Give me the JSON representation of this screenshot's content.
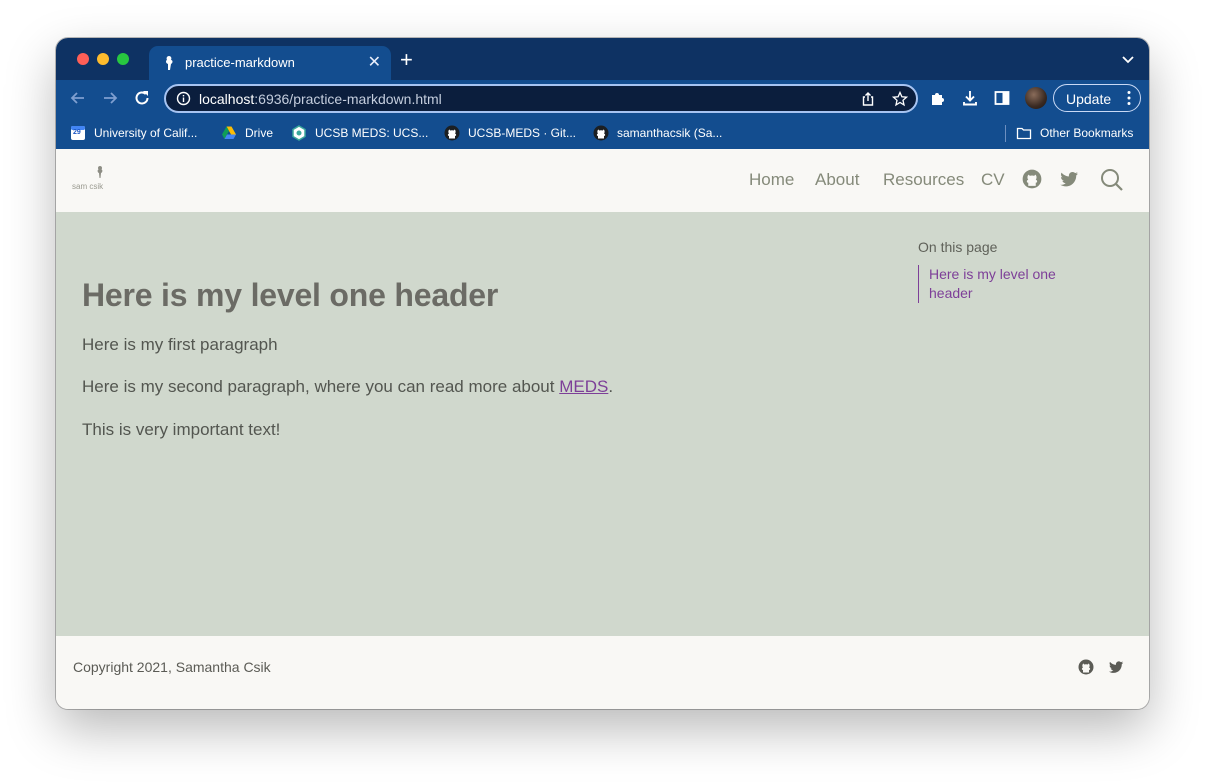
{
  "browser": {
    "tab": {
      "title": "practice-markdown",
      "icon": "quarto-favicon-icon"
    },
    "url": {
      "host": "localhost",
      "rest": ":6936/practice-markdown.html"
    },
    "update_label": "Update",
    "bookmarks": [
      {
        "label": "University of Calif...",
        "icon": "calendar-icon"
      },
      {
        "label": "Drive",
        "icon": "google-drive-icon"
      },
      {
        "label": "UCSB MEDS: UCS...",
        "icon": "meds-hex-icon"
      },
      {
        "label": "UCSB-MEDS · Git...",
        "icon": "github-icon"
      },
      {
        "label": "samanthacsik (Sa...",
        "icon": "github-icon"
      }
    ],
    "other_bookmarks": "Other Bookmarks",
    "calendar_day": "29"
  },
  "site": {
    "logo_text": "sam csik",
    "nav": {
      "home": "Home",
      "about": "About",
      "resources": "Resources",
      "cv": "CV"
    },
    "heading": "Here is my level one header",
    "paragraphs": {
      "first": "Here is my first paragraph",
      "second_before": "Here is my second paragraph, where you can read more about ",
      "second_link": "MEDS",
      "second_after": ".",
      "third": "This is very important text!"
    },
    "toc": {
      "title": "On this page",
      "items": [
        "Here is my level one header"
      ]
    },
    "footer": {
      "copyright": "Copyright 2021, Samantha Csik"
    }
  },
  "colors": {
    "tab_bar": "#0e3263",
    "toolbar": "#134d8f",
    "page_bg": "#d0d8cd",
    "nav_bg": "#f9f8f5",
    "link": "#7d3f98",
    "heading": "#6b6b65"
  }
}
